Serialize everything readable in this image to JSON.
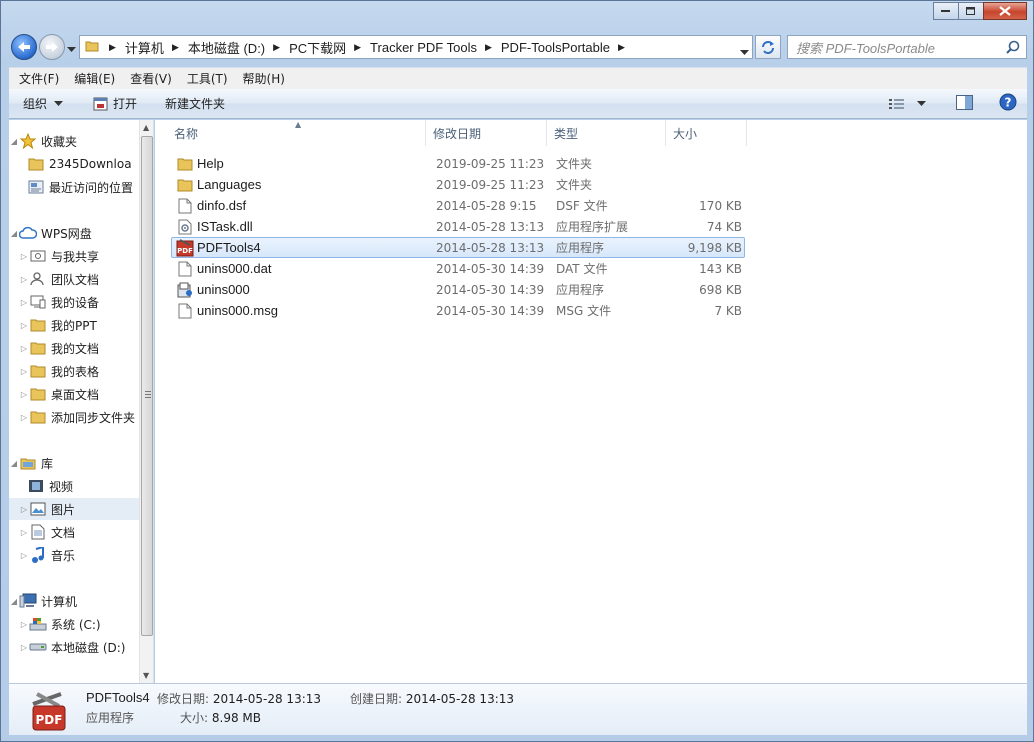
{
  "window": {
    "caption_buttons": [
      "minimize",
      "maximize",
      "close"
    ]
  },
  "address": {
    "crumbs": [
      "计算机",
      "本地磁盘 (D:)",
      "PC下载网",
      "Tracker PDF Tools",
      "PDF-ToolsPortable"
    ]
  },
  "search": {
    "placeholder": "搜索 PDF-ToolsPortable"
  },
  "menu": [
    "文件(F)",
    "编辑(E)",
    "查看(V)",
    "工具(T)",
    "帮助(H)"
  ],
  "toolbar": {
    "organize": "组织",
    "open": "打开",
    "new_folder": "新建文件夹"
  },
  "nav": {
    "favorites": {
      "label": "收藏夹",
      "items": [
        "2345Downloa",
        "最近访问的位置"
      ]
    },
    "wps": {
      "label": "WPS网盘",
      "items": [
        "与我共享",
        "团队文档",
        "我的设备",
        "我的PPT",
        "我的文档",
        "我的表格",
        "桌面文档",
        "添加同步文件夹"
      ]
    },
    "library": {
      "label": "库",
      "items": [
        "视频",
        "图片",
        "文档",
        "音乐"
      ]
    },
    "computer": {
      "label": "计算机",
      "items": [
        "系统 (C:)",
        "本地磁盘 (D:)"
      ]
    }
  },
  "columns": {
    "name": "名称",
    "date": "修改日期",
    "type": "类型",
    "size": "大小"
  },
  "files": [
    {
      "name": "Help",
      "date": "2019-09-25 11:23",
      "type": "文件夹",
      "size": "",
      "icon": "folder-icon"
    },
    {
      "name": "Languages",
      "date": "2019-09-25 11:23",
      "type": "文件夹",
      "size": "",
      "icon": "folder-icon"
    },
    {
      "name": "dinfo.dsf",
      "date": "2014-05-28 9:15",
      "type": "DSF 文件",
      "size": "170 KB",
      "icon": "file-icon"
    },
    {
      "name": "ISTask.dll",
      "date": "2014-05-28 13:13",
      "type": "应用程序扩展",
      "size": "74 KB",
      "icon": "dll-icon"
    },
    {
      "name": "PDFTools4",
      "date": "2014-05-28 13:13",
      "type": "应用程序",
      "size": "9,198 KB",
      "icon": "pdf-app-icon"
    },
    {
      "name": "unins000.dat",
      "date": "2014-05-30 14:39",
      "type": "DAT 文件",
      "size": "143 KB",
      "icon": "file-icon"
    },
    {
      "name": "unins000",
      "date": "2014-05-30 14:39",
      "type": "应用程序",
      "size": "698 KB",
      "icon": "installer-icon"
    },
    {
      "name": "unins000.msg",
      "date": "2014-05-30 14:39",
      "type": "MSG 文件",
      "size": "7 KB",
      "icon": "file-icon"
    }
  ],
  "selected_index": 4,
  "details": {
    "name": "PDFTools4",
    "type": "应用程序",
    "modified_label": "修改日期:",
    "modified": "2014-05-28 13:13",
    "created_label": "创建日期:",
    "created": "2014-05-28 13:13",
    "size_label": "大小:",
    "size": "8.98 MB"
  }
}
